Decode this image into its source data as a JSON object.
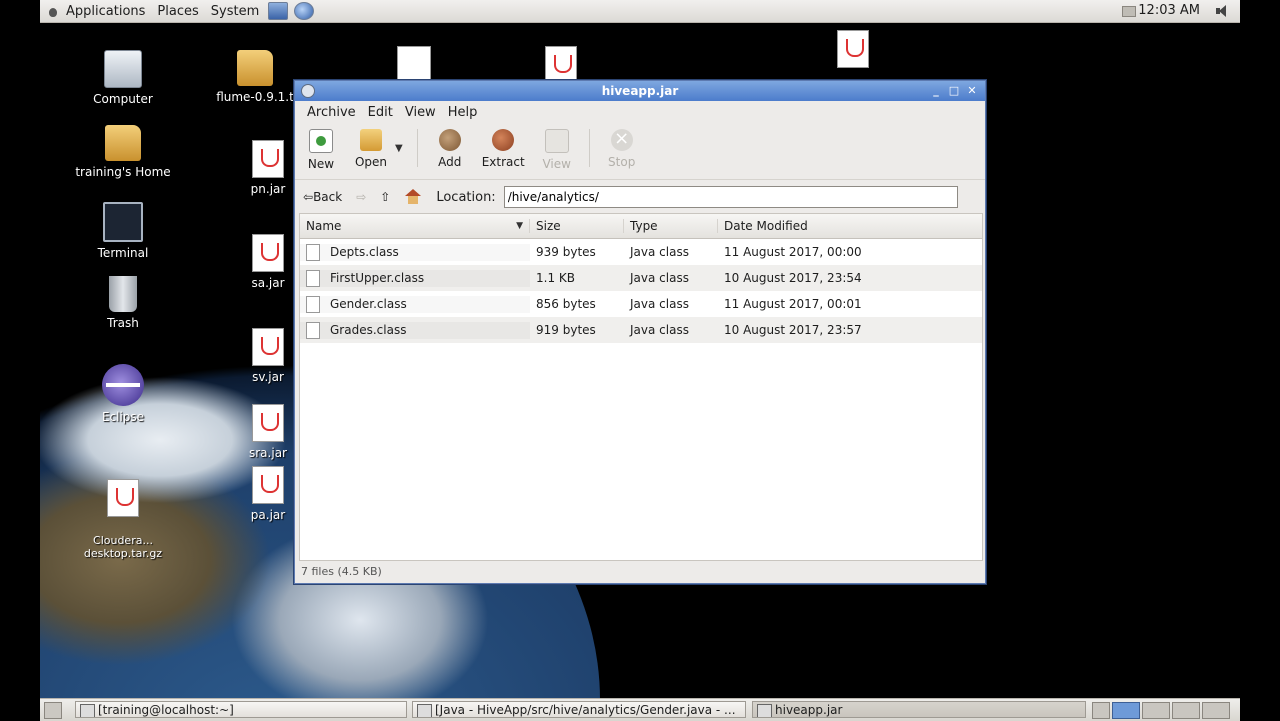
{
  "top_panel": {
    "menus": [
      "Applications",
      "Places",
      "System"
    ],
    "clock": "12:03 AM"
  },
  "desktop": {
    "icons_left": [
      {
        "name": "computer",
        "label": "Computer"
      },
      {
        "name": "home",
        "label": "training's Home"
      },
      {
        "name": "terminal",
        "label": "Terminal"
      },
      {
        "name": "trash",
        "label": "Trash"
      },
      {
        "name": "eclipse",
        "label": "Eclipse"
      },
      {
        "name": "cloudera",
        "label": "Cloudera...\ndesktop.tar.gz"
      }
    ],
    "icons_mid": [
      {
        "name": "flume",
        "label": "flume-0.9.1.t"
      },
      {
        "name": "pn-jar",
        "label": "pn.jar"
      },
      {
        "name": "sa-jar",
        "label": "sa.jar"
      },
      {
        "name": "sv-jar",
        "label": "sv.jar"
      },
      {
        "name": "sra-jar",
        "label": "sra.jar"
      },
      {
        "name": "pa-jar",
        "label": "pa.jar"
      }
    ]
  },
  "window": {
    "title": "hiveapp.jar",
    "menu": [
      "Archive",
      "Edit",
      "View",
      "Help"
    ],
    "toolbar": {
      "new": "New",
      "open": "Open",
      "add": "Add",
      "extract": "Extract",
      "view": "View",
      "stop": "Stop"
    },
    "nav": {
      "back": "Back",
      "location_label": "Location:",
      "location_value": "/hive/analytics/"
    },
    "columns": {
      "name": "Name",
      "size": "Size",
      "type": "Type",
      "date": "Date Modified"
    },
    "files": [
      {
        "name": "Depts.class",
        "size": "939 bytes",
        "type": "Java class",
        "date": "11 August 2017, 00:00"
      },
      {
        "name": "FirstUpper.class",
        "size": "1.1 KB",
        "type": "Java class",
        "date": "10 August 2017, 23:54"
      },
      {
        "name": "Gender.class",
        "size": "856 bytes",
        "type": "Java class",
        "date": "11 August 2017, 00:01"
      },
      {
        "name": "Grades.class",
        "size": "919 bytes",
        "type": "Java class",
        "date": "10 August 2017, 23:57"
      }
    ],
    "status": "7 files (4.5 KB)"
  },
  "taskbar": {
    "tasks": [
      {
        "label": "[training@localhost:~]"
      },
      {
        "label": "[Java - HiveApp/src/hive/analytics/Gender.java - ..."
      },
      {
        "label": "hiveapp.jar"
      }
    ]
  }
}
